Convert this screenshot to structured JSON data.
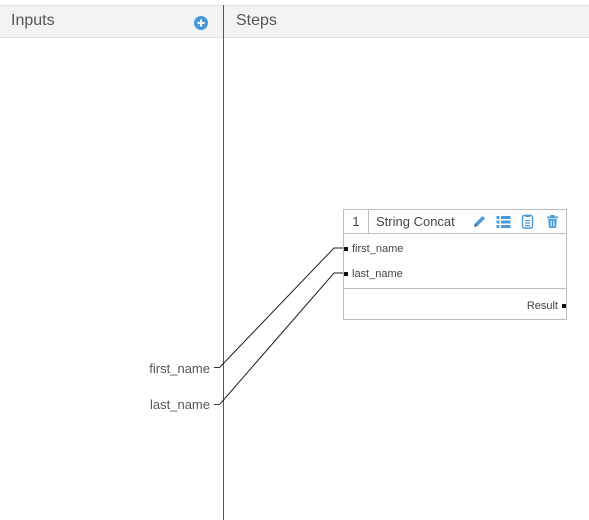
{
  "panels": {
    "inputs_title": "Inputs",
    "steps_title": "Steps"
  },
  "inputs": [
    {
      "label": "first_name"
    },
    {
      "label": "last_name"
    }
  ],
  "step": {
    "number": "1",
    "name": "String Concat",
    "params": [
      "first_name",
      "last_name"
    ],
    "output": "Result"
  },
  "icons": {
    "add": "plus-circle-icon",
    "edit": "pencil-icon",
    "list": "list-icon",
    "copy": "copy-icon",
    "delete": "trash-icon"
  },
  "colors": {
    "accent": "#4a9ad8",
    "header_bg": "#f3f3f3"
  }
}
